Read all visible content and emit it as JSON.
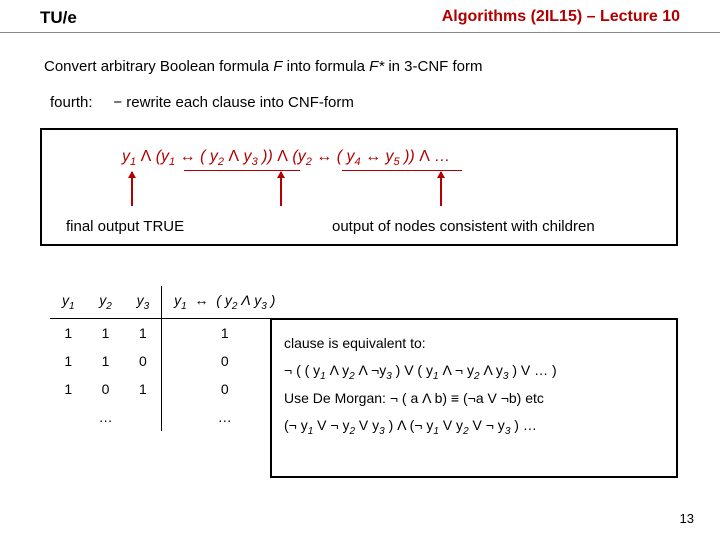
{
  "header": {
    "logo": "TU/e",
    "course": "Algorithms (2IL15) – Lecture 10"
  },
  "intro": "Convert arbitrary Boolean formula F into formula F* in 3-CNF form",
  "step": {
    "label": "fourth:",
    "text": "− rewrite each clause into CNF-form"
  },
  "formula_box": {
    "formula_html": "y<sub>1</sub>  <span class='op'>Λ</span>  (y<sub>1</sub>  ↔  ( y<sub>2</sub> <span class='op'>Λ</span> y<sub>3</sub> ))  <span class='op'>Λ</span>  (y<sub>2</sub>  ↔  ( y<sub>4</sub> ↔ y<sub>5</sub> ))  <span class='op'>Λ</span>  …",
    "label_left": "final output TRUE",
    "label_right": "output of nodes consistent with children"
  },
  "table": {
    "headers": [
      "y₁",
      "y₂",
      "y₃",
      "y₁  ↔  ( y₂ Λ y₃ )"
    ],
    "rows": [
      [
        "1",
        "1",
        "1",
        "1"
      ],
      [
        "1",
        "1",
        "0",
        "0"
      ],
      [
        "1",
        "0",
        "1",
        "0"
      ],
      [
        "",
        "…",
        "",
        "…"
      ]
    ]
  },
  "right_box": {
    "line1": "clause is equivalent to:",
    "line2_html": "¬  (  ( y<sub>1</sub> Λ  y<sub>2</sub> Λ ¬y<sub>3</sub> )    V  ( y<sub>1</sub> Λ ¬ y<sub>2</sub> Λ y<sub>3</sub> ) V … )",
    "line3": "Use De Morgan: ¬ ( a Λ b)  ≡  (¬a V ¬b)  etc",
    "line4_html": "(¬ y<sub>1</sub> V ¬ y<sub>2</sub> V y<sub>3</sub> ) Λ  (¬ y<sub>1</sub> V y<sub>2</sub> V ¬ y<sub>3</sub> ) …"
  },
  "page_number": "13"
}
